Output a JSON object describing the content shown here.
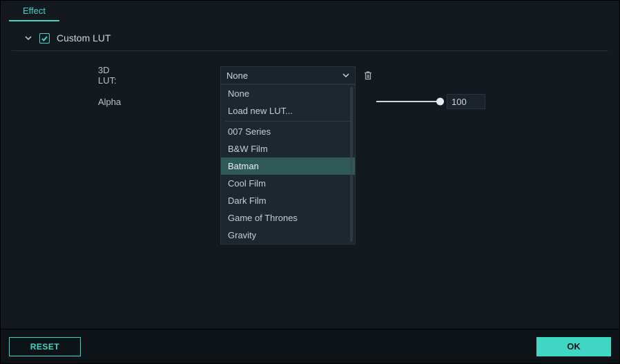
{
  "tabs": {
    "effect": "Effect"
  },
  "section": {
    "checked": true,
    "title": "Custom LUT"
  },
  "fields": {
    "lut": {
      "label": "3D LUT:",
      "selected": "None",
      "options_top": [
        "None",
        "Load new LUT..."
      ],
      "options": [
        "007 Series",
        "B&W Film",
        "Batman",
        "Cool Film",
        "Dark Film",
        "Game of Thrones",
        "Gravity"
      ],
      "highlighted_index": 2
    },
    "alpha": {
      "label": "Alpha",
      "value": "100"
    }
  },
  "buttons": {
    "reset": "RESET",
    "ok": "OK"
  }
}
